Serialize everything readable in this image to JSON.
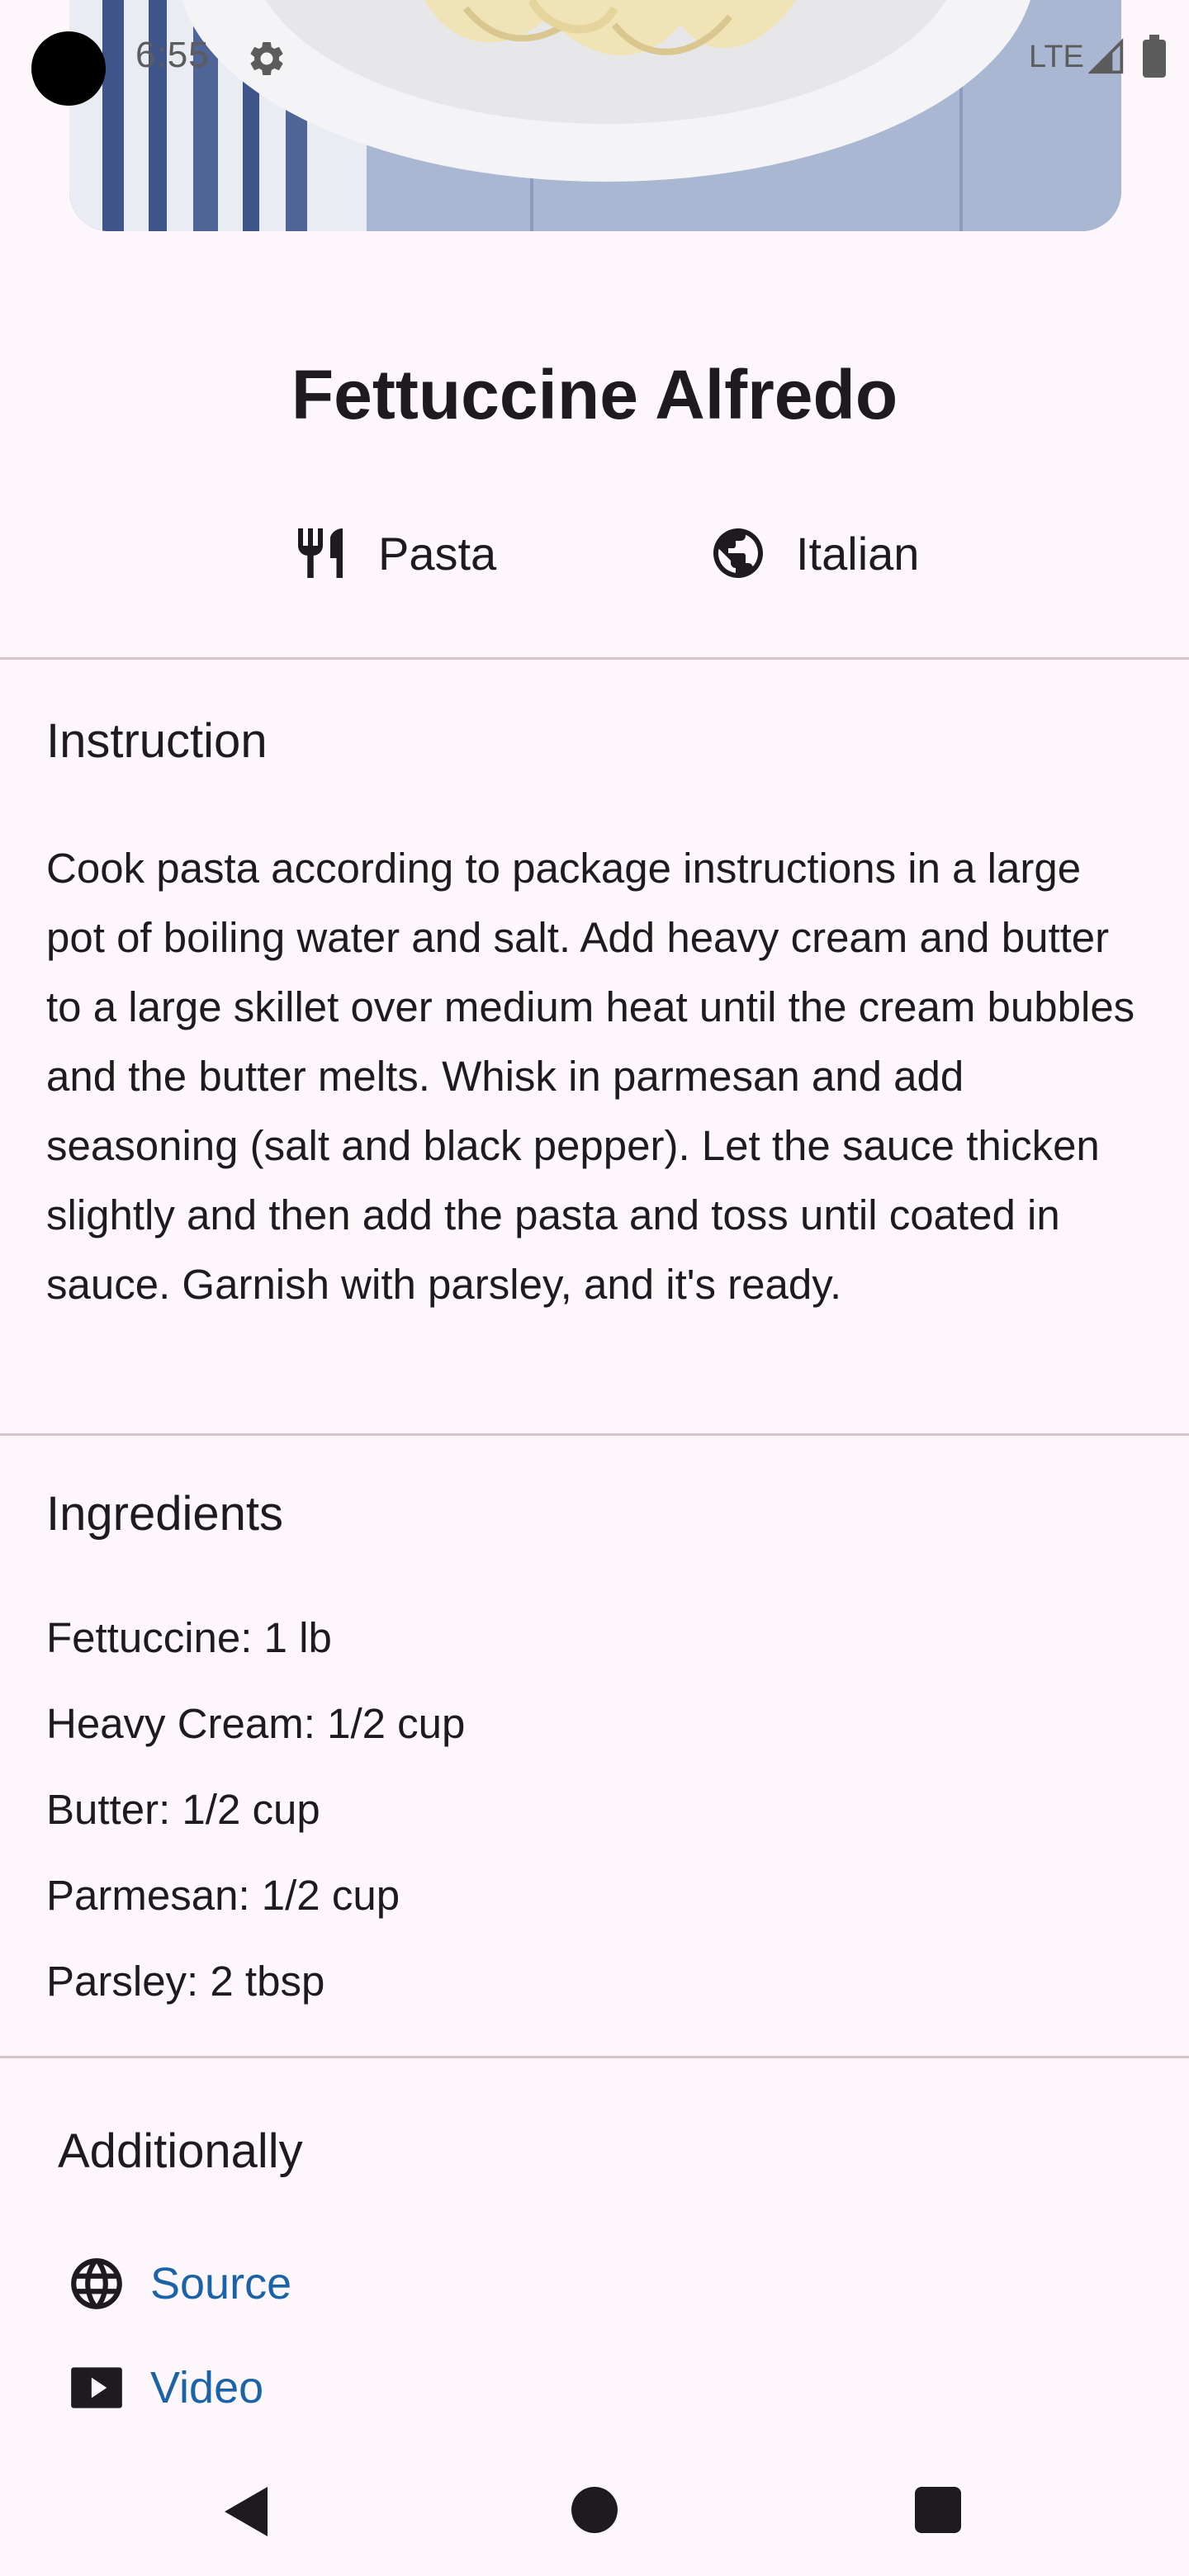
{
  "status_bar": {
    "time": "6:55",
    "network": "LTE",
    "icons": [
      "settings-gear-icon",
      "signal-icon",
      "battery-icon"
    ]
  },
  "recipe": {
    "title": "Fettuccine Alfredo",
    "category": "Pasta",
    "category_icon": "fork-knife-icon",
    "area": "Italian",
    "area_icon": "globe-icon"
  },
  "instruction": {
    "heading": "Instruction",
    "text": "Cook pasta according to package instructions in a large pot of boiling water and salt. Add heavy cream and butter to a large skillet over medium heat until the cream bubbles and the butter melts. Whisk in parmesan and add seasoning (salt and black pepper). Let the sauce thicken slightly and then add the pasta and toss until coated in sauce. Garnish with parsley, and it's ready."
  },
  "ingredients": {
    "heading": "Ingredients",
    "items": [
      "Fettuccine: 1 lb",
      "Heavy Cream: 1/2 cup",
      "Butter: 1/2 cup",
      "Parmesan: 1/2 cup",
      "Parsley: 2 tbsp"
    ]
  },
  "additionally": {
    "heading": "Additionally",
    "links": [
      {
        "label": "Source",
        "icon": "globe-icon"
      },
      {
        "label": "Video",
        "icon": "play-video-icon"
      }
    ]
  },
  "colors": {
    "background": "#fdf7fb",
    "text": "#1d1b1e",
    "link": "#1a63a8",
    "divider": "#d6c6c9"
  },
  "nav_bar": {
    "buttons": [
      "back-icon",
      "home-icon",
      "recents-icon"
    ]
  }
}
